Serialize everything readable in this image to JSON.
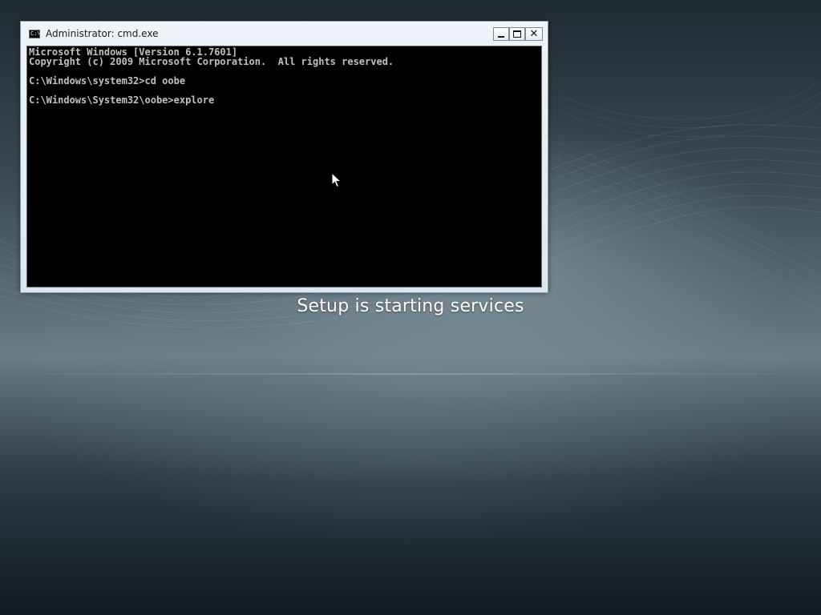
{
  "window": {
    "title": "Administrator: cmd.exe",
    "icon": "cmd-app-icon",
    "icon_label": "C:\\",
    "controls": {
      "minimize": "minimize-icon",
      "maximize": "maximize-icon",
      "close": "close-icon",
      "close_glyph": "✕"
    }
  },
  "console": {
    "lines": [
      "Microsoft Windows [Version 6.1.7601]",
      "Copyright (c) 2009 Microsoft Corporation.  All rights reserved.",
      "",
      "C:\\Windows\\system32>cd oobe",
      "",
      "C:\\Windows\\System32\\oobe>explore"
    ],
    "text_color": "#c0c0c0",
    "background_color": "#000000"
  },
  "setup": {
    "status": "Setup is starting services"
  }
}
